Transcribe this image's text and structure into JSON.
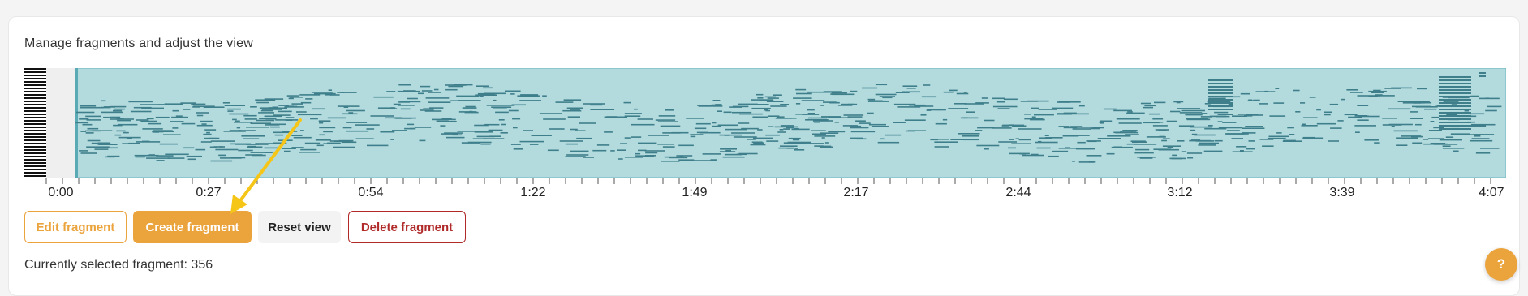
{
  "heading": "Manage fragments and adjust the view",
  "timeline": {
    "labels": [
      "0:00",
      "0:27",
      "0:54",
      "1:22",
      "1:49",
      "2:17",
      "2:44",
      "3:12",
      "3:39",
      "4:07"
    ]
  },
  "buttons": {
    "edit": "Edit fragment",
    "create": "Create fragment",
    "reset": "Reset view",
    "delete": "Delete fragment"
  },
  "status_text": "Currently selected fragment: 356",
  "help": "?",
  "colors": {
    "accent": "#eba33c",
    "roll_fill": "#b3dbde",
    "note": "#3f7f8c",
    "danger": "#b02a2a"
  },
  "icons": {
    "help": "question-mark-icon",
    "annotation": "arrow-icon"
  }
}
